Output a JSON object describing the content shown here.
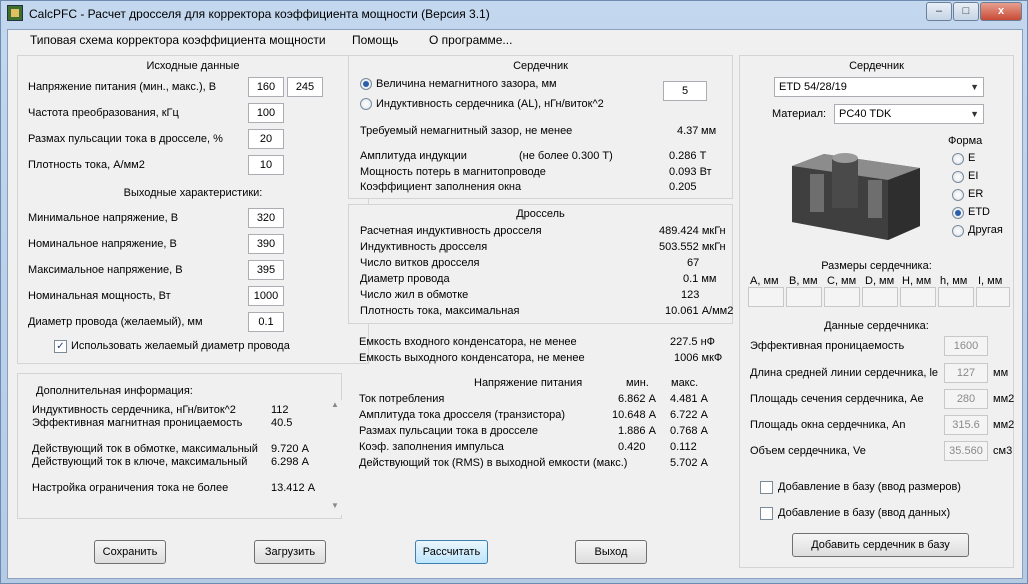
{
  "window": {
    "title": "CalcPFC - Расчет дросселя для корректора коэффициента мощности (Версия 3.1)",
    "minimize": "–",
    "maximize": "□",
    "close": "x"
  },
  "menu": {
    "items": [
      "Типовая схема корректора коэффициента мощности",
      "Помощь",
      "О программе..."
    ]
  },
  "input": {
    "title": "Исходные данные",
    "voltage_label": "Напряжение питания (мин., макс.), В",
    "voltage_min": "160",
    "voltage_max": "245",
    "freq_label": "Частота преобразования, кГц",
    "freq": "100",
    "ripple_label": "Размах пульсации тока в дросселе, %",
    "ripple": "20",
    "density_label": "Плотность тока, А/мм2",
    "density": "10",
    "out_title": "Выходные характеристики:",
    "vmin_label": "Минимальное напряжение, В",
    "vmin": "320",
    "vnom_label": "Номинальное напряжение, В",
    "vnom": "390",
    "vmax_label": "Максимальное напряжение, В",
    "vmax": "395",
    "pnom_label": "Номинальная мощность, Вт",
    "pnom": "1000",
    "wire_label": "Диаметр провода (желаемый), мм",
    "wire": "0.1",
    "use_wire_label": "Использовать желаемый диаметр провода",
    "use_wire_checked": "✓"
  },
  "extra": {
    "title": "Дополнительная информация:",
    "rows": [
      {
        "label": "Индуктивность сердечника, нГн/виток^2",
        "value": "112"
      },
      {
        "label": "Эффективная магнитная проницаемость",
        "value": "40.5"
      },
      {
        "label": "Действующий ток в обмотке, максимальный",
        "value": "9.720 А"
      },
      {
        "label": "Действующий ток в ключе, максимальный",
        "value": "6.298 А"
      },
      {
        "label": "Настройка ограничения тока не более",
        "value": "13.412 А"
      }
    ],
    "scroll_up": "▲",
    "scroll_down": "▼"
  },
  "core_calc": {
    "title": "Сердечник",
    "gap_option": "Величина немагнитного зазора, мм",
    "gap_value": "5",
    "al_option": "Индуктивность сердечника (AL), нГн/виток^2",
    "req_gap_label": "Требуемый немагнитный зазор, не менее",
    "req_gap_value": "4.37",
    "req_gap_unit": "мм",
    "amp_label": "Амплитуда индукции",
    "amp_limit": "(не более   0.300 Т)",
    "amp_value": "0.286 Т",
    "loss_label": "Мощность потерь в магнитопроводе",
    "loss_value": "0.093 Вт",
    "fill_label": "Коэффициент заполнения окна",
    "fill_value": "0.205"
  },
  "choke": {
    "title": "Дроссель",
    "rows": [
      {
        "label": "Расчетная индуктивность дросселя",
        "value": "489.424 мкГн"
      },
      {
        "label": "Индуктивность дросселя",
        "value": "503.552 мкГн"
      },
      {
        "label": "Число витков дросселя",
        "value": "67"
      },
      {
        "label": "Диаметр провода",
        "value": "0.1 мм"
      },
      {
        "label": "Число жил в обмотке",
        "value": "123"
      },
      {
        "label": "Плотность тока, максимальная",
        "value": "10.061 А/мм2"
      }
    ]
  },
  "caps": {
    "in_label": "Емкость входного конденсатора, не менее",
    "in_value": "227.5 нФ",
    "out_label": "Емкость выходного конденсатора, не менее",
    "out_value": "1006 мкФ",
    "supply_title": "Напряжение питания",
    "col_min": "мин.",
    "col_max": "макс.",
    "rows": [
      {
        "label": "Ток потребления",
        "min": "6.862 А",
        "max": "4.481 А"
      },
      {
        "label": "Амплитуда тока дросселя (транзистора)",
        "min": "10.648 А",
        "max": "6.722 А"
      },
      {
        "label": "Размах пульсации тока в дросселе",
        "min": "1.886 А",
        "max": "0.768 А"
      },
      {
        "label": "Коэф. заполнения импульса",
        "min": "0.420",
        "max": "0.112"
      },
      {
        "label": "Действующий ток (RMS) в выходной емкости (макс.)",
        "min": "",
        "max": "5.702 А"
      }
    ]
  },
  "core_sel": {
    "title": "Сердечник",
    "core_value": "ETD 54/28/19",
    "material_label": "Материал:",
    "material_value": "PC40 TDK",
    "shape_title": "Форма",
    "shapes": [
      "E",
      "EI",
      "ER",
      "ETD",
      "Другая"
    ],
    "dims_title": "Размеры сердечника:",
    "dims": [
      "A, мм",
      "B, мм",
      "C, мм",
      "D, мм",
      "H, мм",
      "h, мм",
      "I, мм"
    ],
    "data_title": "Данные сердечника:",
    "perm_label": "Эффективная проницаемость",
    "perm_value": "1600",
    "le_label": "Длина средней линии сердечника, le",
    "le_value": "127",
    "le_unit": "мм",
    "ae_label": "Площадь сечения сердечника, Ae",
    "ae_value": "280",
    "ae_unit": "мм2",
    "an_label": "Площадь окна сердечника, An",
    "an_value": "315.6",
    "an_unit": "мм2",
    "ve_label": "Объем сердечника, Ve",
    "ve_value": "35.560",
    "ve_unit": "см3",
    "add_dims_label": "Добавление в базу (ввод размеров)",
    "add_data_label": "Добавление в базу (ввод данных)",
    "add_core_button": "Добавить сердечник в базу"
  },
  "buttons": {
    "save": "Сохранить",
    "load": "Загрузить",
    "calc": "Рассчитать",
    "exit": "Выход"
  }
}
